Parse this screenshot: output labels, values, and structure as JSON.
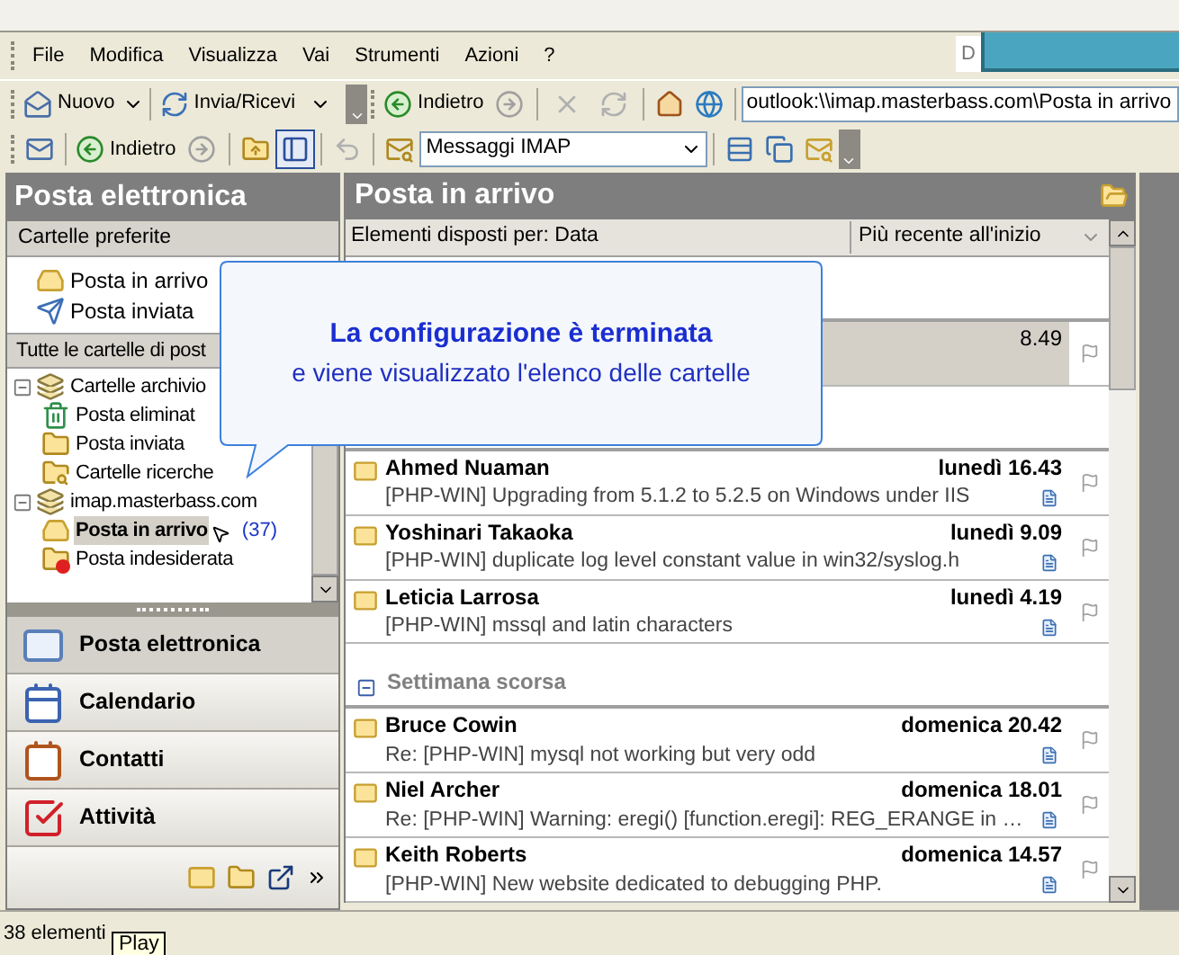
{
  "top_fragment": "D",
  "menu": [
    "File",
    "Modifica",
    "Visualizza",
    "Vai",
    "Strumenti",
    "Azioni",
    "?"
  ],
  "toolbar_1": {
    "new": "Nuovo",
    "send_receive": "Invia/Ricevi",
    "back": "Indietro",
    "address": "outlook:\\\\imap.masterbass.com\\Posta in arrivo"
  },
  "toolbar_2": {
    "back": "Indietro",
    "view_pressed": true,
    "folder_combo": "Messaggi IMAP"
  },
  "navigation_pane": {
    "title": "Posta elettronica",
    "favorites_header": "Cartelle preferite",
    "favorites": [
      {
        "label": "Posta in arrivo",
        "kind": "inbox"
      },
      {
        "label": "Posta inviata",
        "kind": "sent"
      }
    ],
    "all_folders_header": "Tutte le cartelle di post",
    "tree": [
      {
        "label": "Cartelle archivio",
        "kind": "store",
        "expanded": true,
        "children": [
          {
            "label": "Posta eliminat",
            "kind": "trash",
            "selected": false
          },
          {
            "label": "Posta inviata",
            "kind": "folder",
            "selected": false
          },
          {
            "label": "Cartelle ricerche",
            "kind": "search",
            "selected": false
          }
        ]
      },
      {
        "label": "imap.masterbass.com",
        "kind": "store",
        "expanded": true,
        "children": [
          {
            "label": "Posta in arrivo",
            "kind": "inbox",
            "selected": true,
            "count": "(37)"
          },
          {
            "label": "Posta indesiderata",
            "kind": "junk",
            "selected": false
          }
        ]
      }
    ],
    "buttons": [
      {
        "label": "Posta elettronica",
        "kind": "mail",
        "selected": true
      },
      {
        "label": "Calendario",
        "kind": "calendar",
        "selected": false
      },
      {
        "label": "Contatti",
        "kind": "contacts",
        "selected": false
      },
      {
        "label": "Attività",
        "kind": "tasks",
        "selected": false
      }
    ]
  },
  "inbox": {
    "title": "Posta in arrivo",
    "sort_by": "Elementi disposti per: Data",
    "order": "Più recente all'inizio",
    "items": [
      {
        "kind": "group"
      },
      {
        "kind": "message",
        "selected": true,
        "time": "8.49"
      },
      {
        "kind": "group"
      },
      {
        "kind": "message",
        "selected": false,
        "sender": "Ahmed Nuaman",
        "time": "lunedì 16.43",
        "subject": "[PHP-WIN] Upgrading from 5.1.2 to 5.2.5 on Windows under IIS"
      },
      {
        "kind": "message",
        "selected": false,
        "sender": "Yoshinari Takaoka",
        "time": "lunedì 9.09",
        "subject": "[PHP-WIN] duplicate log level constant value in win32/syslog.h"
      },
      {
        "kind": "message",
        "selected": false,
        "sender": "Leticia Larrosa",
        "time": "lunedì 4.19",
        "subject": "[PHP-WIN] mssql and latin characters"
      },
      {
        "kind": "group",
        "label": "Settimana scorsa"
      },
      {
        "kind": "message",
        "selected": false,
        "sender": "Bruce Cowin",
        "time": "domenica 20.42",
        "subject": "Re: [PHP-WIN] mysql not working but very odd"
      },
      {
        "kind": "message",
        "selected": false,
        "sender": "Niel Archer",
        "time": "domenica 18.01",
        "subject": "Re: [PHP-WIN] Warning: eregi() [function.eregi]: REG_ERANGE in …"
      },
      {
        "kind": "message",
        "selected": false,
        "sender": "Keith Roberts",
        "time": "domenica 14.57",
        "subject": "[PHP-WIN] New website dedicated to debugging PHP."
      }
    ]
  },
  "callout": {
    "title": "La configurazione è terminata",
    "text": "e viene visualizzato l'elenco delle cartelle"
  },
  "status_bar": {
    "count": "38 elementi",
    "tooltip": "Play"
  }
}
